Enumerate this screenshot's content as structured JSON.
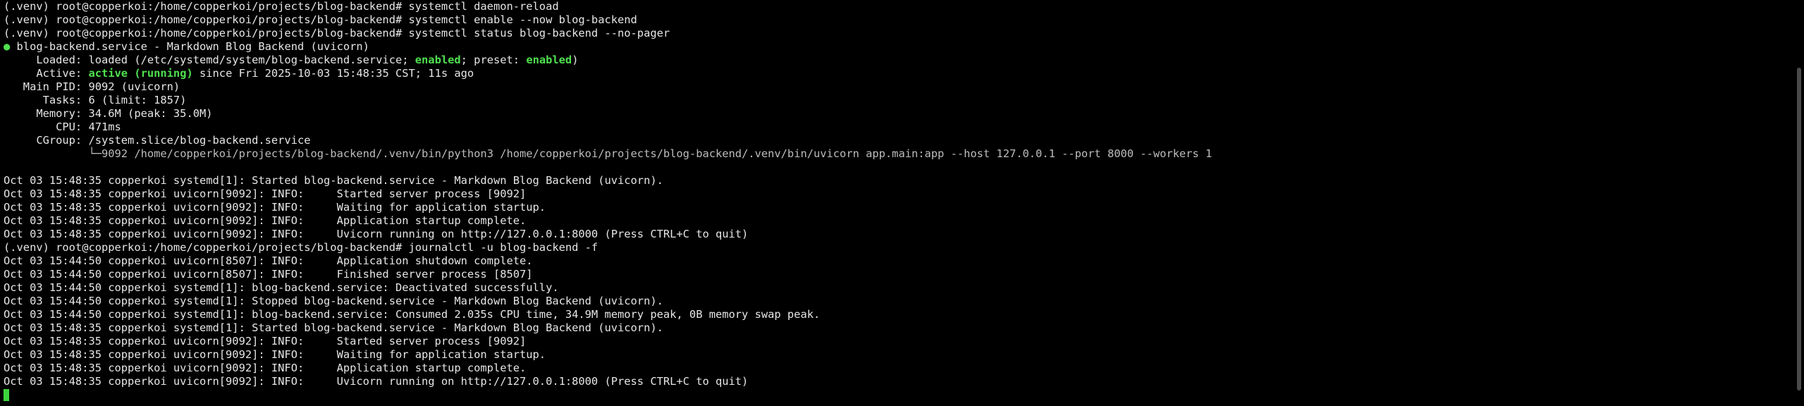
{
  "status": {
    "accent_green": "#4fe04f",
    "cursor_color": "#3cd63c"
  },
  "lines": {
    "l1": "(.venv) root@copperkoi:/home/copperkoi/projects/blog-backend# systemctl daemon-reload",
    "l2": "(.venv) root@copperkoi:/home/copperkoi/projects/blog-backend# systemctl enable --now blog-backend",
    "l3": "(.venv) root@copperkoi:/home/copperkoi/projects/blog-backend# systemctl status blog-backend --no-pager",
    "l4_dot": "●",
    "l4_rest": " blog-backend.service - Markdown Blog Backend (uvicorn)",
    "l5_a": "     Loaded: loaded (/etc/systemd/system/blog-backend.service; ",
    "l5_enabled1": "enabled",
    "l5_b": "; preset: ",
    "l5_enabled2": "enabled",
    "l5_c": ")",
    "l6_a": "     Active: ",
    "l6_active": "active (running)",
    "l6_b": " since Fri 2025-10-03 15:48:35 CST; 11s ago",
    "l7": "   Main PID: 9092 (uvicorn)",
    "l8": "      Tasks: 6 (limit: 1857)",
    "l9": "     Memory: 34.6M (peak: 35.0M)",
    "l10": "        CPU: 471ms",
    "l11": "     CGroup: /system.slice/blog-backend.service",
    "l12_indent": "             ",
    "l12": "└─9092 /home/copperkoi/projects/blog-backend/.venv/bin/python3 /home/copperkoi/projects/blog-backend/.venv/bin/uvicorn app.main:app --host 127.0.0.1 --port 8000 --workers 1",
    "l13": "",
    "l14": "Oct 03 15:48:35 copperkoi systemd[1]: Started blog-backend.service - Markdown Blog Backend (uvicorn).",
    "l15": "Oct 03 15:48:35 copperkoi uvicorn[9092]: INFO:     Started server process [9092]",
    "l16": "Oct 03 15:48:35 copperkoi uvicorn[9092]: INFO:     Waiting for application startup.",
    "l17": "Oct 03 15:48:35 copperkoi uvicorn[9092]: INFO:     Application startup complete.",
    "l18": "Oct 03 15:48:35 copperkoi uvicorn[9092]: INFO:     Uvicorn running on http://127.0.0.1:8000 (Press CTRL+C to quit)",
    "l19": "(.venv) root@copperkoi:/home/copperkoi/projects/blog-backend# journalctl -u blog-backend -f",
    "l20": "Oct 03 15:44:50 copperkoi uvicorn[8507]: INFO:     Application shutdown complete.",
    "l21": "Oct 03 15:44:50 copperkoi uvicorn[8507]: INFO:     Finished server process [8507]",
    "l22": "Oct 03 15:44:50 copperkoi systemd[1]: blog-backend.service: Deactivated successfully.",
    "l23": "Oct 03 15:44:50 copperkoi systemd[1]: Stopped blog-backend.service - Markdown Blog Backend (uvicorn).",
    "l24": "Oct 03 15:44:50 copperkoi systemd[1]: blog-backend.service: Consumed 2.035s CPU time, 34.9M memory peak, 0B memory swap peak.",
    "l25": "Oct 03 15:48:35 copperkoi systemd[1]: Started blog-backend.service - Markdown Blog Backend (uvicorn).",
    "l26": "Oct 03 15:48:35 copperkoi uvicorn[9092]: INFO:     Started server process [9092]",
    "l27": "Oct 03 15:48:35 copperkoi uvicorn[9092]: INFO:     Waiting for application startup.",
    "l28": "Oct 03 15:48:35 copperkoi uvicorn[9092]: INFO:     Application startup complete.",
    "l29": "Oct 03 15:48:35 copperkoi uvicorn[9092]: INFO:     Uvicorn running on http://127.0.0.1:8000 (Press CTRL+C to quit)"
  }
}
